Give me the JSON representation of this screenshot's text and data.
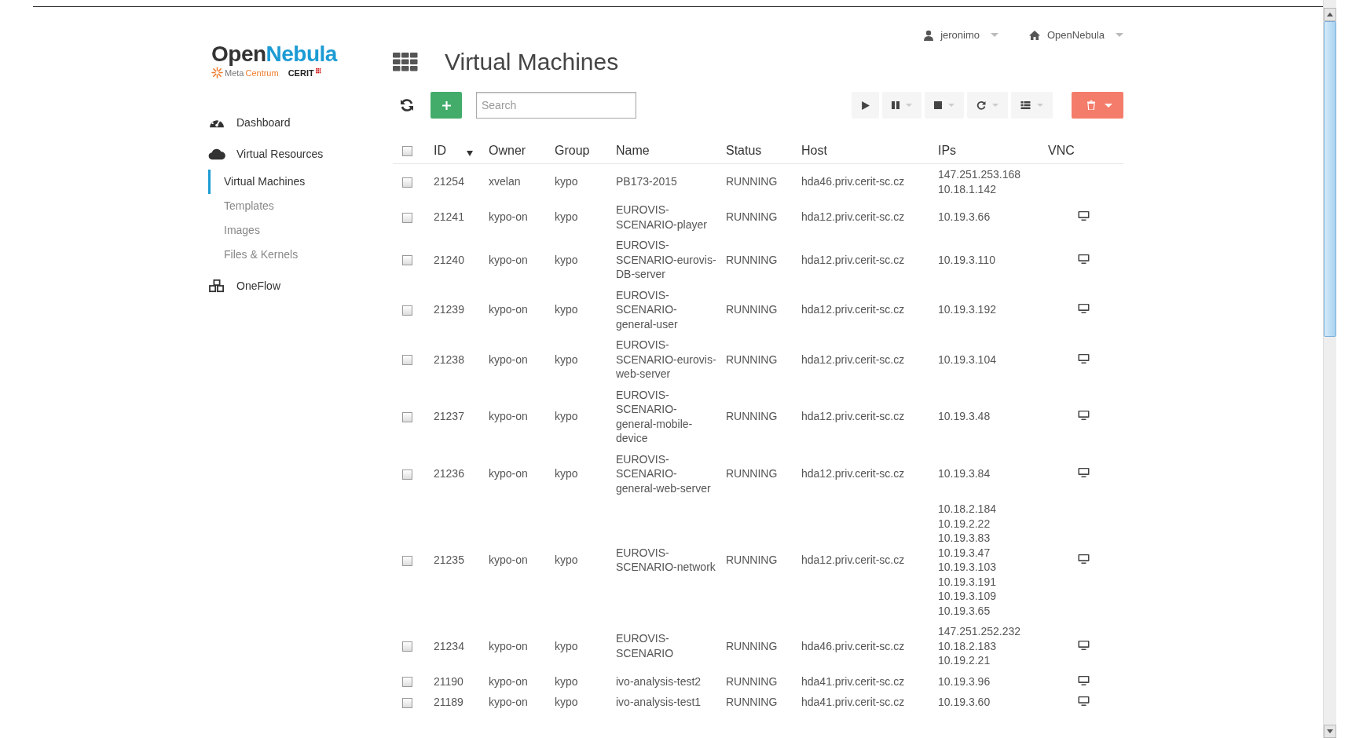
{
  "user_menu": {
    "user": "jeronimo",
    "zone": "OpenNebula"
  },
  "logo": {
    "title_dark": "Open",
    "title_accent": "Nebula",
    "sub_a": "Meta",
    "sub_b": "Centrum",
    "sub_c": "CERIT"
  },
  "sidebar": {
    "items": [
      {
        "label": "Dashboard",
        "selected": false
      },
      {
        "label": "Virtual Resources",
        "selected": false,
        "children": [
          {
            "label": "Virtual Machines",
            "selected": true
          },
          {
            "label": "Templates",
            "selected": false
          },
          {
            "label": "Images",
            "selected": false
          },
          {
            "label": "Files & Kernels",
            "selected": false
          }
        ]
      },
      {
        "label": "OneFlow",
        "selected": false
      }
    ]
  },
  "page": {
    "title": "Virtual Machines"
  },
  "toolbar": {
    "search": {
      "placeholder": "Search"
    }
  },
  "table": {
    "select_all_checked": false,
    "columns": [
      "ID",
      "Owner",
      "Group",
      "Name",
      "Status",
      "Host",
      "IPs",
      "VNC"
    ],
    "rows": [
      {
        "checked": false,
        "id": "21254",
        "owner": "xvelan",
        "group": "kypo",
        "name": "PB173-2015",
        "status": "RUNNING",
        "host": "hda46.priv.cerit-sc.cz",
        "ips": [
          "147.251.253.168",
          "10.18.1.142"
        ],
        "vnc": false
      },
      {
        "checked": false,
        "id": "21241",
        "owner": "kypo-on",
        "group": "kypo",
        "name": "EUROVIS-SCENARIO-player",
        "status": "RUNNING",
        "host": "hda12.priv.cerit-sc.cz",
        "ips": [
          "10.19.3.66"
        ],
        "vnc": true
      },
      {
        "checked": false,
        "id": "21240",
        "owner": "kypo-on",
        "group": "kypo",
        "name": "EUROVIS-SCENARIO-eurovis-DB-server",
        "status": "RUNNING",
        "host": "hda12.priv.cerit-sc.cz",
        "ips": [
          "10.19.3.110"
        ],
        "vnc": true
      },
      {
        "checked": false,
        "id": "21239",
        "owner": "kypo-on",
        "group": "kypo",
        "name": "EUROVIS-SCENARIO-general-user",
        "status": "RUNNING",
        "host": "hda12.priv.cerit-sc.cz",
        "ips": [
          "10.19.3.192"
        ],
        "vnc": true
      },
      {
        "checked": false,
        "id": "21238",
        "owner": "kypo-on",
        "group": "kypo",
        "name": "EUROVIS-SCENARIO-eurovis-web-server",
        "status": "RUNNING",
        "host": "hda12.priv.cerit-sc.cz",
        "ips": [
          "10.19.3.104"
        ],
        "vnc": true
      },
      {
        "checked": false,
        "id": "21237",
        "owner": "kypo-on",
        "group": "kypo",
        "name": "EUROVIS-SCENARIO-general-mobile-device",
        "status": "RUNNING",
        "host": "hda12.priv.cerit-sc.cz",
        "ips": [
          "10.19.3.48"
        ],
        "vnc": true
      },
      {
        "checked": false,
        "id": "21236",
        "owner": "kypo-on",
        "group": "kypo",
        "name": "EUROVIS-SCENARIO-general-web-server",
        "status": "RUNNING",
        "host": "hda12.priv.cerit-sc.cz",
        "ips": [
          "10.19.3.84"
        ],
        "vnc": true
      },
      {
        "checked": false,
        "id": "21235",
        "owner": "kypo-on",
        "group": "kypo",
        "name": "EUROVIS-SCENARIO-network",
        "status": "RUNNING",
        "host": "hda12.priv.cerit-sc.cz",
        "ips": [
          "10.18.2.184",
          "10.19.2.22",
          "10.19.3.83",
          "10.19.3.47",
          "10.19.3.103",
          "10.19.3.191",
          "10.19.3.109",
          "10.19.3.65"
        ],
        "vnc": true
      },
      {
        "checked": false,
        "id": "21234",
        "owner": "kypo-on",
        "group": "kypo",
        "name": "EUROVIS-SCENARIO",
        "status": "RUNNING",
        "host": "hda46.priv.cerit-sc.cz",
        "ips": [
          "147.251.252.232",
          "10.18.2.183",
          "10.19.2.21"
        ],
        "vnc": true
      },
      {
        "checked": false,
        "id": "21190",
        "owner": "kypo-on",
        "group": "kypo",
        "name": "ivo-analysis-test2",
        "status": "RUNNING",
        "host": "hda41.priv.cerit-sc.cz",
        "ips": [
          "10.19.3.96"
        ],
        "vnc": true
      },
      {
        "checked": false,
        "id": "21189",
        "owner": "kypo-on",
        "group": "kypo",
        "name": "ivo-analysis-test1",
        "status": "RUNNING",
        "host": "hda41.priv.cerit-sc.cz",
        "ips": [
          "10.19.3.60"
        ],
        "vnc": true
      }
    ]
  }
}
